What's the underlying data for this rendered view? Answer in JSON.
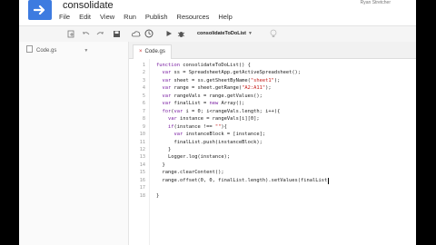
{
  "app": {
    "title": "consolidate",
    "user": "Ryan Stretcher",
    "menu": [
      "File",
      "Edit",
      "View",
      "Run",
      "Publish",
      "Resources",
      "Help"
    ]
  },
  "toolbar": {
    "function_name": "consolidateToDoList",
    "icons": [
      "add-file-icon",
      "undo-icon",
      "redo-icon",
      "save-icon",
      "triggers-icon",
      "history-icon",
      "run-icon",
      "debug-icon",
      "lightbulb-icon"
    ]
  },
  "sidebar": {
    "files": [
      {
        "name": "Code.gs"
      }
    ]
  },
  "tabs": [
    {
      "label": "Code.gs",
      "active": true
    }
  ],
  "code": {
    "line_numbers": [
      "1",
      "2",
      "3",
      "4",
      "5",
      "6",
      "7",
      "8",
      "9",
      "10",
      "11",
      "12",
      "13",
      "14",
      "15",
      "16",
      "17",
      "18"
    ],
    "lines": [
      "function consolidateToDoList() {",
      "  var ss = SpreadsheetApp.getActiveSpreadsheet();",
      "  var sheet = ss.getSheetByName(\"sheet1\");",
      "  var range = sheet.getRange(\"A2:A11\");",
      "  var rangeVals = range.getValues();",
      "  var finalList = new Array();",
      "  for(var i = 0; i<rangeVals.length; i++){",
      "    var instance = rangeVals[i][0];",
      "    if(instance !== \"\"){",
      "      var instanceBlock = [instance];",
      "      finalList.push(instanceBlock);",
      "    }",
      "    Logger.log(instance);",
      "  }",
      "  range.clearContent();",
      "  range.offset(0, 0, finalList.length).setValues(finalList",
      "",
      "}"
    ]
  }
}
